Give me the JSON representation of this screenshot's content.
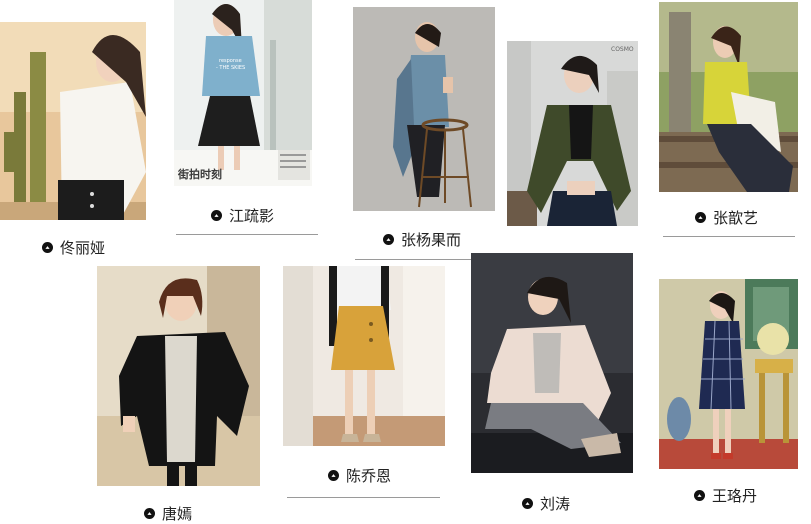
{
  "gallery": {
    "items": [
      {
        "name": "佟丽娅",
        "photo_icon": "portrait-white-blouse-cactus"
      },
      {
        "name": "江疏影",
        "photo_icon": "magazine-page-blue-sweater"
      },
      {
        "name": "张杨果而",
        "photo_icon": "portrait-blue-top-stool"
      },
      {
        "name": "",
        "photo_icon": "portrait-green-satin-jacket"
      },
      {
        "name": "张歆艺",
        "photo_icon": "portrait-yellow-sweater-fence"
      },
      {
        "name": "唐嫣",
        "photo_icon": "portrait-black-leather-jacket"
      },
      {
        "name": "陈乔恩",
        "photo_icon": "portrait-mustard-skirt"
      },
      {
        "name": "刘涛",
        "photo_icon": "portrait-cream-coat-plaid-pants"
      },
      {
        "name": "王珞丹",
        "photo_icon": "portrait-plaid-dress-interior"
      }
    ]
  },
  "magazine_text": {
    "sweater_print": "- THE SKIES",
    "sweater_brand": "response",
    "headline": "街拍时刻",
    "cover_tag": "COSMO"
  },
  "colors": {
    "label_text": "#222222",
    "rule": "#9a9a9a",
    "icon_bg": "#111111"
  }
}
